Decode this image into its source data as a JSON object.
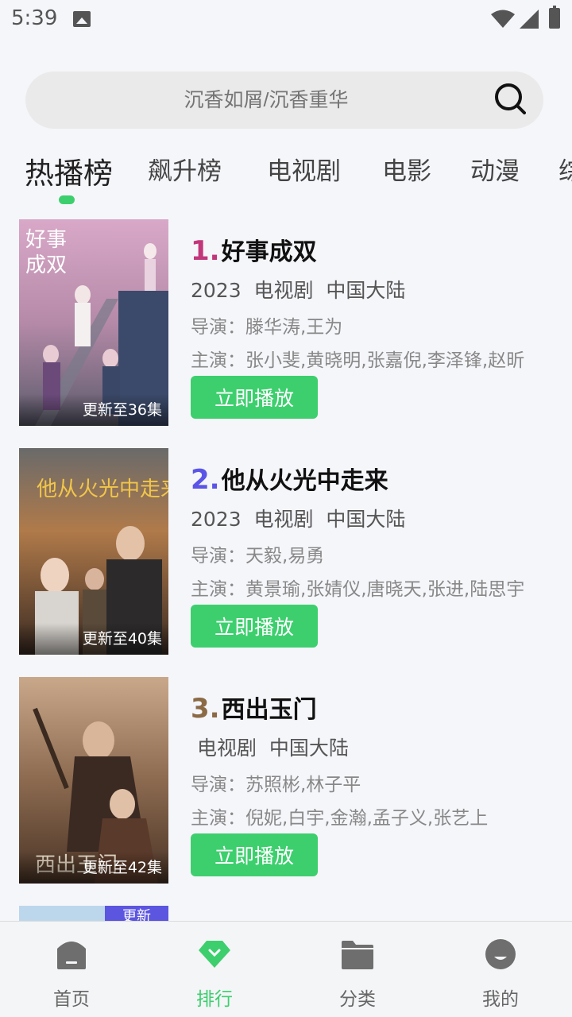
{
  "status_bar": {
    "time": "5:39"
  },
  "search": {
    "placeholder": "沉香如屑/沉香重华"
  },
  "tabs": [
    {
      "label": "热播榜",
      "active": true
    },
    {
      "label": "飙升榜"
    },
    {
      "label": "电视剧"
    },
    {
      "label": "电影"
    },
    {
      "label": "动漫"
    },
    {
      "label": "综"
    }
  ],
  "list": [
    {
      "rank": "1.",
      "rank_color": "#c2367a",
      "title": "好事成双",
      "meta": "2023  电视剧  中国大陆",
      "director": "导演：滕华涛,王为",
      "cast": "主演：张小斐,黄晓明,张嘉倪,李泽锋,赵昕",
      "badge": "更新至36集",
      "play_label": "立即播放"
    },
    {
      "rank": "2.",
      "rank_color": "#5a55e6",
      "title": "他从火光中走来",
      "meta": "2023  电视剧  中国大陆",
      "director": "导演：天毅,易勇",
      "cast": "主演：黄景瑜,张婧仪,唐晓天,张进,陆思宇",
      "badge": "更新至40集",
      "play_label": "立即播放"
    },
    {
      "rank": "3.",
      "rank_color": "#8b6a45",
      "title": "西出玉门",
      "meta": " 电视剧  中国大陆",
      "director": "导演：苏照彬,林子平",
      "cast": "主演：倪妮,白宇,金瀚,孟子义,张艺上",
      "badge": "更新至42集",
      "play_label": "立即播放"
    }
  ],
  "partial_item": {
    "badge": "更新"
  },
  "bottom_nav": [
    {
      "label": "首页",
      "icon": "home-icon"
    },
    {
      "label": "排行",
      "icon": "rank-diamond-icon",
      "active": true
    },
    {
      "label": "分类",
      "icon": "folder-icon"
    },
    {
      "label": "我的",
      "icon": "profile-icon"
    }
  ],
  "colors": {
    "accent": "#3dcf6e",
    "background": "#f5f6fa"
  }
}
